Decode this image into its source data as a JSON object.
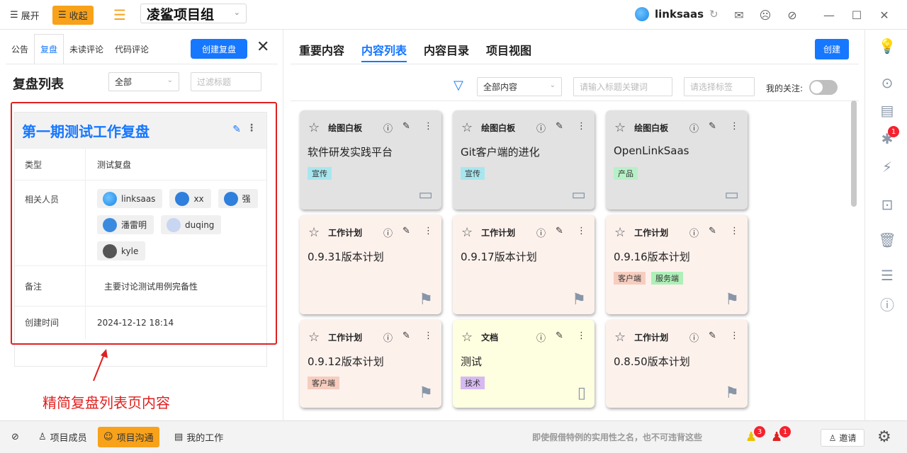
{
  "topbar": {
    "expand_label": "展开",
    "collapse_label": "收起",
    "project_name": "凌鲨项目组",
    "user_name": "linksaas"
  },
  "left": {
    "tabs": [
      "公告",
      "复盘",
      "未读评论",
      "代码评论"
    ],
    "create_button": "创建复盘",
    "list_title": "复盘列表",
    "filter_select": "全部",
    "filter_placeholder": "过滤标题",
    "card": {
      "title": "第一期测试工作复盘",
      "type_label": "类型",
      "type_value": "测试复盘",
      "members_label": "相关人员",
      "members": [
        "linksaas",
        "xx",
        "强",
        "潘雷明",
        "duqing",
        "kyle"
      ],
      "note_label": "备注",
      "note_value": "主要讨论测试用例完备性",
      "created_label": "创建时间",
      "created_value": "2024-12-12 18:14"
    },
    "annotation": "精简复盘列表页内容"
  },
  "main": {
    "tabs": [
      "重要内容",
      "内容列表",
      "内容目录",
      "项目视图"
    ],
    "create_button": "创建",
    "content_select": "全部内容",
    "keyword_placeholder": "请输入标题关键词",
    "tag_placeholder": "请选择标签",
    "my_follow_label": "我的关注:",
    "cards": [
      {
        "kind": "绘图白板",
        "title": "软件研发实践平台",
        "tags": [
          {
            "text": "宣传",
            "color": "#a8e6ef"
          }
        ],
        "bg": "#e2e2e2",
        "icon": "whiteboard-icon"
      },
      {
        "kind": "绘图白板",
        "title": "Git客户端的进化",
        "tags": [
          {
            "text": "宣传",
            "color": "#a8e6ef"
          }
        ],
        "bg": "#e2e2e2",
        "icon": "whiteboard-icon"
      },
      {
        "kind": "绘图白板",
        "title": "OpenLinkSaas",
        "tags": [
          {
            "text": "产品",
            "color": "#b7f0c8"
          }
        ],
        "bg": "#e2e2e2",
        "icon": "whiteboard-icon"
      },
      {
        "kind": "工作计划",
        "title": "0.9.31版本计划",
        "tags": [],
        "bg": "#fdf1ec",
        "icon": "flag-icon"
      },
      {
        "kind": "工作计划",
        "title": "0.9.17版本计划",
        "tags": [],
        "bg": "#fdf1ec",
        "icon": "flag-icon"
      },
      {
        "kind": "工作计划",
        "title": "0.9.16版本计划",
        "tags": [
          {
            "text": "客户端",
            "color": "#f6cdbf"
          },
          {
            "text": "服务端",
            "color": "#aef0b8"
          }
        ],
        "bg": "#fdf1ec",
        "icon": "flag-icon"
      },
      {
        "kind": "工作计划",
        "title": "0.9.12版本计划",
        "tags": [
          {
            "text": "客户端",
            "color": "#f6cdbf"
          }
        ],
        "bg": "#fdf1ec",
        "icon": "flag-icon"
      },
      {
        "kind": "文档",
        "title": "测试",
        "tags": [
          {
            "text": "技术",
            "color": "#d7b9f2"
          }
        ],
        "bg": "#fefee0",
        "icon": "document-icon"
      },
      {
        "kind": "工作计划",
        "title": "0.8.50版本计划",
        "tags": [],
        "bg": "#fdf1ec",
        "icon": "flag-icon"
      }
    ]
  },
  "rail": {
    "bug_badge": "1"
  },
  "bottom": {
    "members_label": "项目成员",
    "chat_label": "项目沟通",
    "work_label": "我的工作",
    "slogan": "即使假借特例的实用性之名，也不可违背这些",
    "notice_badge": "3",
    "alarm_badge": "1",
    "invite_label": "邀请"
  }
}
